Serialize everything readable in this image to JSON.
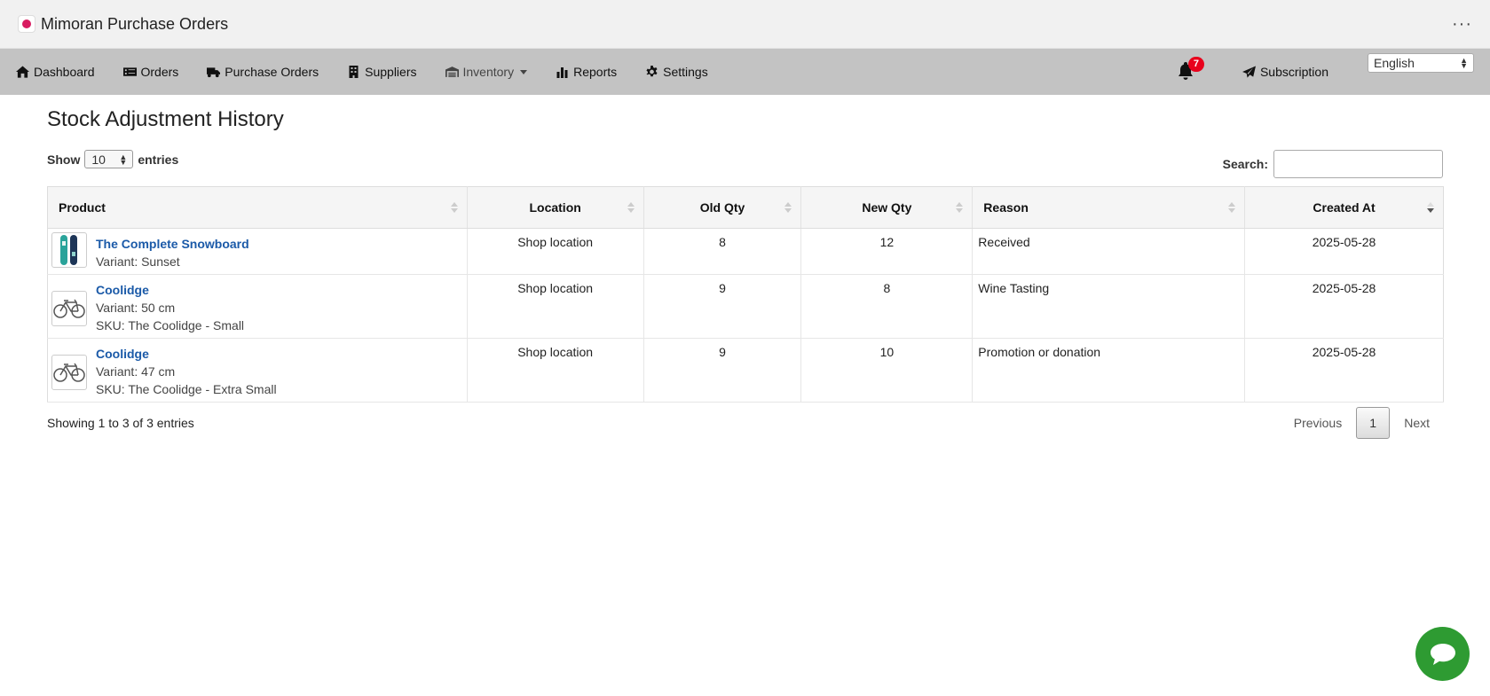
{
  "app": {
    "title": "Mimoran Purchase Orders",
    "more": "···"
  },
  "nav": {
    "dashboard": "Dashboard",
    "orders": "Orders",
    "purchase_orders": "Purchase Orders",
    "suppliers": "Suppliers",
    "inventory": "Inventory",
    "reports": "Reports",
    "settings": "Settings",
    "notifications_count": "7",
    "subscription": "Subscription",
    "language": "English"
  },
  "page": {
    "title": "Stock Adjustment History"
  },
  "table_controls": {
    "show_label": "Show",
    "page_length": "10",
    "entries_label": "entries",
    "search_label": "Search:",
    "search_value": ""
  },
  "table": {
    "headers": {
      "product": "Product",
      "location": "Location",
      "old_qty": "Old Qty",
      "new_qty": "New Qty",
      "reason": "Reason",
      "created_at": "Created At"
    },
    "rows": [
      {
        "product": "The Complete Snowboard",
        "variant": "Variant: Sunset",
        "sku": "",
        "location": "Shop location",
        "old_qty": "8",
        "new_qty": "12",
        "reason": "Received",
        "created_at": "2025-05-28",
        "thumb_icon": "snowboard-icon"
      },
      {
        "product": "Coolidge",
        "variant": "Variant: 50 cm",
        "sku": "SKU: The Coolidge - Small",
        "location": "Shop location",
        "old_qty": "9",
        "new_qty": "8",
        "reason": "Wine Tasting",
        "created_at": "2025-05-28",
        "thumb_icon": "bicycle-icon"
      },
      {
        "product": "Coolidge",
        "variant": "Variant: 47 cm",
        "sku": "SKU: The Coolidge - Extra Small",
        "location": "Shop location",
        "old_qty": "9",
        "new_qty": "10",
        "reason": "Promotion or donation",
        "created_at": "2025-05-28",
        "thumb_icon": "bicycle-icon"
      }
    ]
  },
  "footer": {
    "info": "Showing 1 to 3 of 3 entries",
    "previous": "Previous",
    "current_page": "1",
    "next": "Next"
  },
  "colors": {
    "navbar": "#c3c3c3",
    "link": "#1b5aa8",
    "badge": "#e8001c",
    "chat": "#2e9b32"
  }
}
